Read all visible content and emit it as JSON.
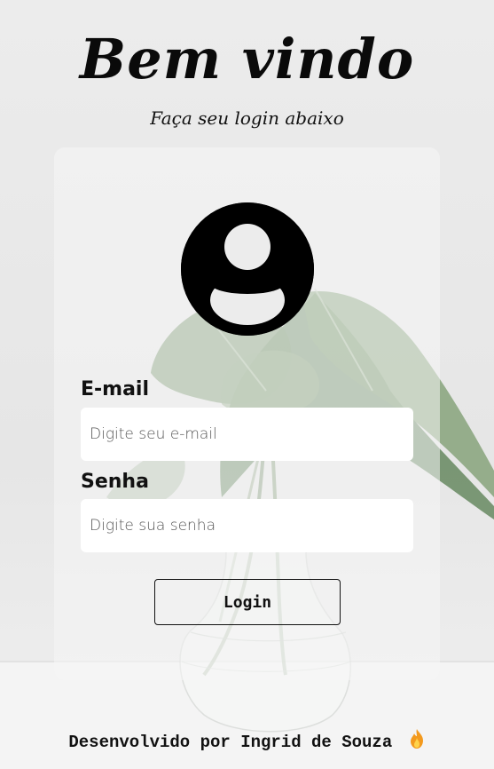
{
  "header": {
    "title": "Bem vindo",
    "subtitle": "Faça seu login abaixo"
  },
  "form": {
    "avatar_icon": "user-circle-icon",
    "email": {
      "label": "E-mail",
      "placeholder": "Digite seu e-mail",
      "value": ""
    },
    "senha": {
      "label": "Senha",
      "placeholder": "Digite sua senha",
      "value": ""
    },
    "login_label": "Login"
  },
  "footer": {
    "text": "Desenvolvido por Ingrid de Souza",
    "icon": "fire-icon"
  },
  "colors": {
    "background": "#eaeaea",
    "text": "#111111",
    "input_bg": "#ffffff",
    "leaf": "#6f8f64"
  }
}
